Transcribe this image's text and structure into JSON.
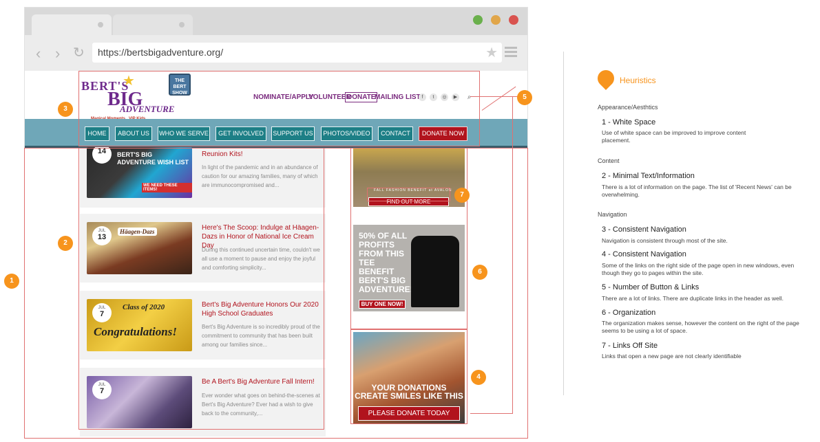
{
  "browser": {
    "url": "https://bertsbigadventure.org/"
  },
  "site": {
    "logo": {
      "line1": "BERT'S",
      "line2": "BIG",
      "line3": "ADVENTURE",
      "tagline": "Magical Moments...VIP Kids"
    },
    "bert_show": "THE BERT SHOW",
    "top_links": [
      "NOMINATE/APPLY",
      "VOLUNTEER",
      "DONATE",
      "MAILING LIST"
    ],
    "nav": [
      "HOME",
      "ABOUT US",
      "WHO WE SERVE",
      "GET INVOLVED",
      "SUPPORT US",
      "PHOTOS/VIDEO",
      "CONTACT",
      "DONATE NOW"
    ],
    "news": [
      {
        "month": "",
        "day": "14",
        "thumb_text": "BERT'S BIG ADVENTURE WISH LIST",
        "thumb_sub": "WE NEED THESE ITEMS!",
        "title": "Reunion Kits!",
        "excerpt": "In light of the pandemic and in an abundance of caution for our amazing families, many of which are immunocompromised and..."
      },
      {
        "month": "JUL",
        "day": "13",
        "thumb_text": "Häagen-Dazs",
        "title": "Here's The Scoop: Indulge at Häagen-Dazs in Honor of National Ice Cream Day",
        "excerpt": "During this continued uncertain time, couldn't we all use a moment to pause and enjoy the joyful and comforting simplicity..."
      },
      {
        "month": "JUL",
        "day": "7",
        "thumb_text": "Class of 2020",
        "thumb_sub": "Congratulations!",
        "title": "Bert's Big Adventure Honors Our 2020 High School Graduates",
        "excerpt": "Bert's Big Adventure is so incredibly proud of the commitment to community that has been built among our families since..."
      },
      {
        "month": "JUL",
        "day": "7",
        "title": "Be A Bert's Big Adventure Fall Intern!",
        "excerpt": "Ever wonder what goes on behind-the-scenes at Bert's Big Adventure? Ever had a wish to give back to the community,..."
      }
    ],
    "ads": {
      "fashion_caption": "FALL FASHION BENEFIT at AVALON",
      "find_out_more": "FIND OUT MORE",
      "tee_text": "50% OF ALL PROFITS FROM THIS TEE BENEFIT BERT'S BIG ADVENTURE!",
      "buy_one_now": "BUY ONE NOW!",
      "donations_text": "YOUR DONATIONS CREATE SMILES LIKE THIS",
      "please_donate": "PLEASE DONATE TODAY"
    }
  },
  "markers": [
    "1",
    "2",
    "3",
    "4",
    "5",
    "6",
    "7"
  ],
  "panel": {
    "title": "Heuristics",
    "sections": [
      {
        "name": "Appearance/Aesthtics",
        "items": [
          {
            "title": "1 - White Space",
            "desc": "Use of white space can be improved to improve content placement."
          }
        ]
      },
      {
        "name": "Content",
        "items": [
          {
            "title": "2 - Minimal Text/Information",
            "desc": "There is a lot of information on the page. The list of 'Recent News' can be overwhelming."
          }
        ]
      },
      {
        "name": "Navigation",
        "items": [
          {
            "title": "3 - Consistent Navigation",
            "desc": "Navigation is consistent through most of the site."
          },
          {
            "title": "4 - Consistent Navigation",
            "desc": "Some of the links on the right side of the page open in new windows, even though they go to pages within the site."
          },
          {
            "title": "5 - Number of Button & Links",
            "desc": "There are a lot of links. There are duplicate links in the header as well."
          },
          {
            "title": "6 - Organization",
            "desc": "The organization makes sense, however the content on the right of the page seems to be using a lot of space."
          },
          {
            "title": "7 - Links Off Site",
            "desc": "Links that open a new page are not clearly identifiable"
          }
        ]
      }
    ]
  },
  "colors": {
    "accent": "#f7941d",
    "nav_teal": "#1d7f86",
    "donate_red": "#b1131d",
    "link_purple": "#7a2a7e",
    "highlight": "#e07070"
  }
}
